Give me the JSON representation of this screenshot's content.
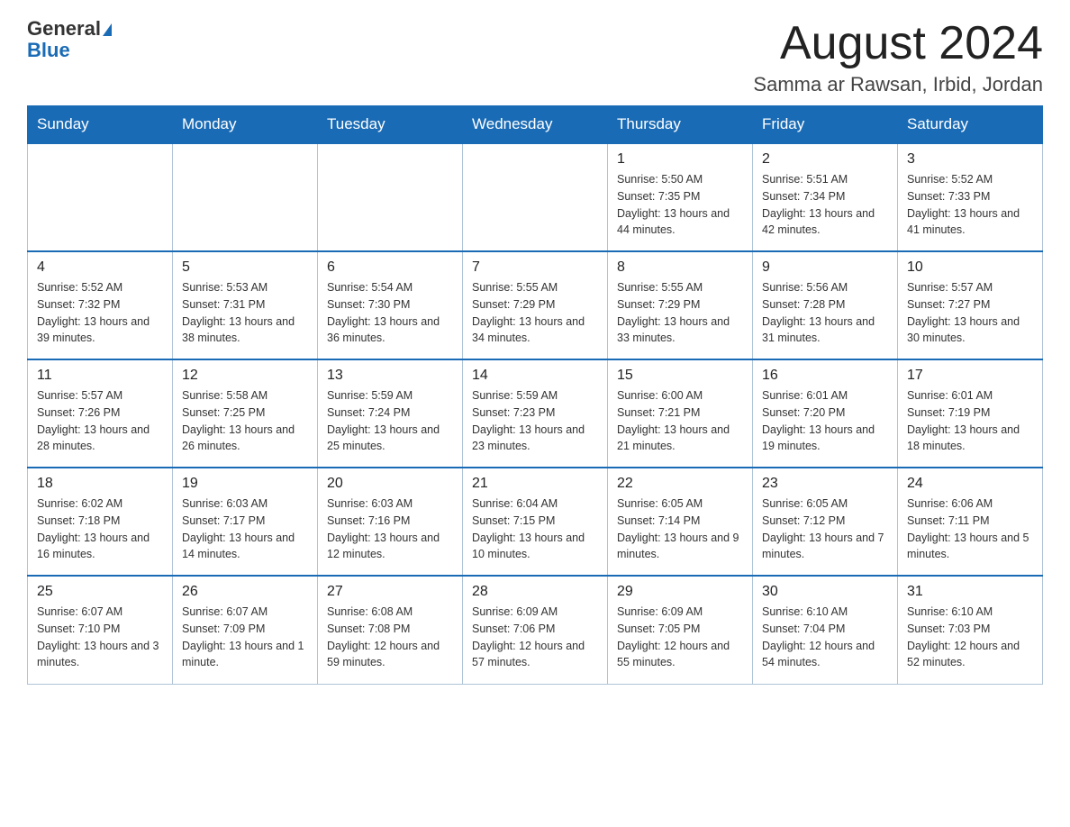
{
  "header": {
    "logo_general": "General",
    "logo_blue": "Blue",
    "title": "August 2024",
    "subtitle": "Samma ar Rawsan, Irbid, Jordan"
  },
  "days_of_week": [
    "Sunday",
    "Monday",
    "Tuesday",
    "Wednesday",
    "Thursday",
    "Friday",
    "Saturday"
  ],
  "weeks": [
    {
      "days": [
        {
          "num": "",
          "sunrise": "",
          "sunset": "",
          "daylight": ""
        },
        {
          "num": "",
          "sunrise": "",
          "sunset": "",
          "daylight": ""
        },
        {
          "num": "",
          "sunrise": "",
          "sunset": "",
          "daylight": ""
        },
        {
          "num": "",
          "sunrise": "",
          "sunset": "",
          "daylight": ""
        },
        {
          "num": "1",
          "sunrise": "Sunrise: 5:50 AM",
          "sunset": "Sunset: 7:35 PM",
          "daylight": "Daylight: 13 hours and 44 minutes."
        },
        {
          "num": "2",
          "sunrise": "Sunrise: 5:51 AM",
          "sunset": "Sunset: 7:34 PM",
          "daylight": "Daylight: 13 hours and 42 minutes."
        },
        {
          "num": "3",
          "sunrise": "Sunrise: 5:52 AM",
          "sunset": "Sunset: 7:33 PM",
          "daylight": "Daylight: 13 hours and 41 minutes."
        }
      ]
    },
    {
      "days": [
        {
          "num": "4",
          "sunrise": "Sunrise: 5:52 AM",
          "sunset": "Sunset: 7:32 PM",
          "daylight": "Daylight: 13 hours and 39 minutes."
        },
        {
          "num": "5",
          "sunrise": "Sunrise: 5:53 AM",
          "sunset": "Sunset: 7:31 PM",
          "daylight": "Daylight: 13 hours and 38 minutes."
        },
        {
          "num": "6",
          "sunrise": "Sunrise: 5:54 AM",
          "sunset": "Sunset: 7:30 PM",
          "daylight": "Daylight: 13 hours and 36 minutes."
        },
        {
          "num": "7",
          "sunrise": "Sunrise: 5:55 AM",
          "sunset": "Sunset: 7:29 PM",
          "daylight": "Daylight: 13 hours and 34 minutes."
        },
        {
          "num": "8",
          "sunrise": "Sunrise: 5:55 AM",
          "sunset": "Sunset: 7:29 PM",
          "daylight": "Daylight: 13 hours and 33 minutes."
        },
        {
          "num": "9",
          "sunrise": "Sunrise: 5:56 AM",
          "sunset": "Sunset: 7:28 PM",
          "daylight": "Daylight: 13 hours and 31 minutes."
        },
        {
          "num": "10",
          "sunrise": "Sunrise: 5:57 AM",
          "sunset": "Sunset: 7:27 PM",
          "daylight": "Daylight: 13 hours and 30 minutes."
        }
      ]
    },
    {
      "days": [
        {
          "num": "11",
          "sunrise": "Sunrise: 5:57 AM",
          "sunset": "Sunset: 7:26 PM",
          "daylight": "Daylight: 13 hours and 28 minutes."
        },
        {
          "num": "12",
          "sunrise": "Sunrise: 5:58 AM",
          "sunset": "Sunset: 7:25 PM",
          "daylight": "Daylight: 13 hours and 26 minutes."
        },
        {
          "num": "13",
          "sunrise": "Sunrise: 5:59 AM",
          "sunset": "Sunset: 7:24 PM",
          "daylight": "Daylight: 13 hours and 25 minutes."
        },
        {
          "num": "14",
          "sunrise": "Sunrise: 5:59 AM",
          "sunset": "Sunset: 7:23 PM",
          "daylight": "Daylight: 13 hours and 23 minutes."
        },
        {
          "num": "15",
          "sunrise": "Sunrise: 6:00 AM",
          "sunset": "Sunset: 7:21 PM",
          "daylight": "Daylight: 13 hours and 21 minutes."
        },
        {
          "num": "16",
          "sunrise": "Sunrise: 6:01 AM",
          "sunset": "Sunset: 7:20 PM",
          "daylight": "Daylight: 13 hours and 19 minutes."
        },
        {
          "num": "17",
          "sunrise": "Sunrise: 6:01 AM",
          "sunset": "Sunset: 7:19 PM",
          "daylight": "Daylight: 13 hours and 18 minutes."
        }
      ]
    },
    {
      "days": [
        {
          "num": "18",
          "sunrise": "Sunrise: 6:02 AM",
          "sunset": "Sunset: 7:18 PM",
          "daylight": "Daylight: 13 hours and 16 minutes."
        },
        {
          "num": "19",
          "sunrise": "Sunrise: 6:03 AM",
          "sunset": "Sunset: 7:17 PM",
          "daylight": "Daylight: 13 hours and 14 minutes."
        },
        {
          "num": "20",
          "sunrise": "Sunrise: 6:03 AM",
          "sunset": "Sunset: 7:16 PM",
          "daylight": "Daylight: 13 hours and 12 minutes."
        },
        {
          "num": "21",
          "sunrise": "Sunrise: 6:04 AM",
          "sunset": "Sunset: 7:15 PM",
          "daylight": "Daylight: 13 hours and 10 minutes."
        },
        {
          "num": "22",
          "sunrise": "Sunrise: 6:05 AM",
          "sunset": "Sunset: 7:14 PM",
          "daylight": "Daylight: 13 hours and 9 minutes."
        },
        {
          "num": "23",
          "sunrise": "Sunrise: 6:05 AM",
          "sunset": "Sunset: 7:12 PM",
          "daylight": "Daylight: 13 hours and 7 minutes."
        },
        {
          "num": "24",
          "sunrise": "Sunrise: 6:06 AM",
          "sunset": "Sunset: 7:11 PM",
          "daylight": "Daylight: 13 hours and 5 minutes."
        }
      ]
    },
    {
      "days": [
        {
          "num": "25",
          "sunrise": "Sunrise: 6:07 AM",
          "sunset": "Sunset: 7:10 PM",
          "daylight": "Daylight: 13 hours and 3 minutes."
        },
        {
          "num": "26",
          "sunrise": "Sunrise: 6:07 AM",
          "sunset": "Sunset: 7:09 PM",
          "daylight": "Daylight: 13 hours and 1 minute."
        },
        {
          "num": "27",
          "sunrise": "Sunrise: 6:08 AM",
          "sunset": "Sunset: 7:08 PM",
          "daylight": "Daylight: 12 hours and 59 minutes."
        },
        {
          "num": "28",
          "sunrise": "Sunrise: 6:09 AM",
          "sunset": "Sunset: 7:06 PM",
          "daylight": "Daylight: 12 hours and 57 minutes."
        },
        {
          "num": "29",
          "sunrise": "Sunrise: 6:09 AM",
          "sunset": "Sunset: 7:05 PM",
          "daylight": "Daylight: 12 hours and 55 minutes."
        },
        {
          "num": "30",
          "sunrise": "Sunrise: 6:10 AM",
          "sunset": "Sunset: 7:04 PM",
          "daylight": "Daylight: 12 hours and 54 minutes."
        },
        {
          "num": "31",
          "sunrise": "Sunrise: 6:10 AM",
          "sunset": "Sunset: 7:03 PM",
          "daylight": "Daylight: 12 hours and 52 minutes."
        }
      ]
    }
  ]
}
